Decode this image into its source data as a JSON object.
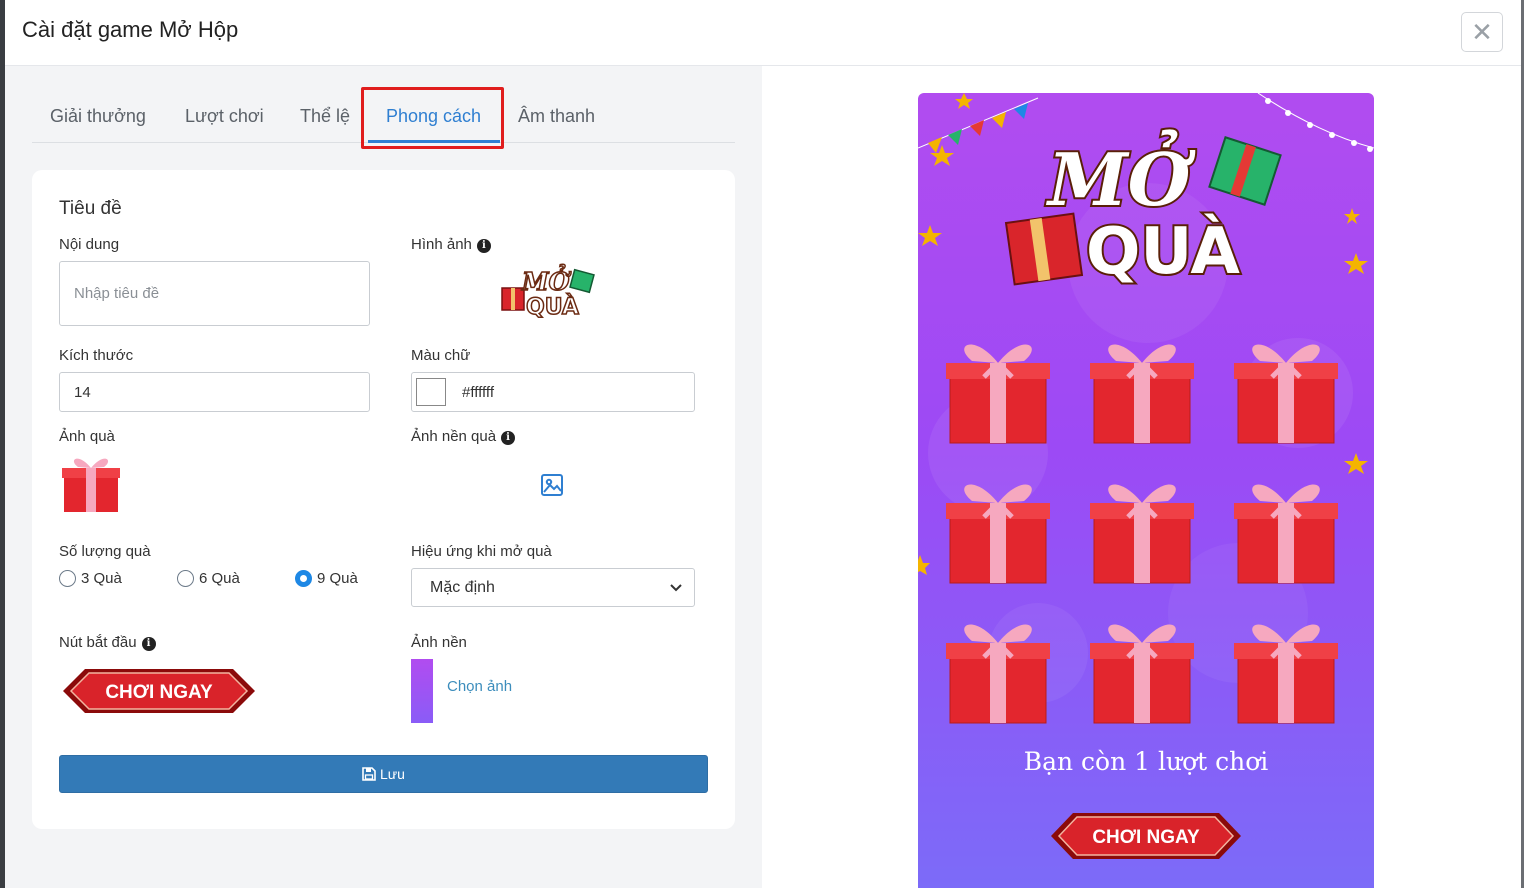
{
  "modal": {
    "title": "Cài đặt game Mở Hộp",
    "close_label": "✕"
  },
  "tabs": [
    {
      "label": "Giải thưởng"
    },
    {
      "label": "Lượt chơi"
    },
    {
      "label": "Thể lệ"
    },
    {
      "label": "Phong cách",
      "active": true
    },
    {
      "label": "Âm thanh"
    }
  ],
  "form": {
    "section_title": "Tiêu đề",
    "content_label": "Nội dung",
    "content_placeholder": "Nhập tiêu đề",
    "image_label": "Hình ảnh",
    "logo_text_top": "MỞ",
    "logo_text_bottom": "QUÀ",
    "size_label": "Kích thước",
    "size_value": "14",
    "text_color_label": "Màu chữ",
    "text_color_value": "#ffffff",
    "gift_image_label": "Ảnh quà",
    "gift_bg_label": "Ảnh nền quà",
    "gift_count_label": "Số lượng quà",
    "gift_count_options": [
      "3 Quà",
      "6 Quà",
      "9 Quà"
    ],
    "gift_count_selected": "9 Quà",
    "effect_label": "Hiệu ứng khi mở quà",
    "effect_value": "Mặc định",
    "start_button_label": "Nút bắt đầu",
    "start_button_text": "CHƠI NGAY",
    "background_label": "Ảnh nền",
    "choose_image_label": "Chọn ảnh",
    "save_label": "Lưu"
  },
  "preview": {
    "logo_top": "MỞ",
    "logo_bottom": "QUÀ",
    "remaining_text": "Bạn còn 1 lượt chơi",
    "play_button_text": "CHƠI NGAY",
    "gift_count": 9
  },
  "colors": {
    "accent": "#2f7fd1",
    "save_button": "#337ab7",
    "highlight": "#e01d1d",
    "preview_bg_top": "#b14cf0",
    "preview_bg_bottom": "#7c6bf8",
    "gift_red": "#e3262e",
    "ribbon_pink": "#f6a8bf"
  }
}
